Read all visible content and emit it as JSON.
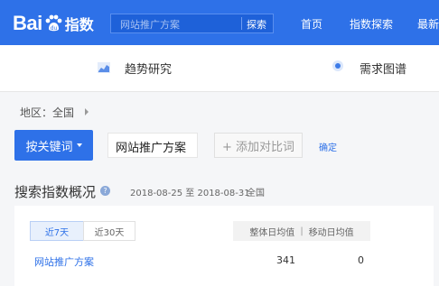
{
  "header": {
    "logo_text": "Bai",
    "logo_suffix": "指数",
    "search_placeholder": "网站推广方案",
    "search_button": "探索",
    "nav": [
      "首页",
      "指数探索",
      "最新"
    ]
  },
  "subnav": {
    "trend_label": "趋势研究",
    "map_label": "需求图谱"
  },
  "filters": {
    "region": "地区：全国",
    "keyword_button": "按关键词",
    "keyword_value": "网站推广方案",
    "add_compare": "+ 添加对比词",
    "confirm": "确定"
  },
  "overview": {
    "title": "搜索指数概况",
    "date_range": "2018-08-25 至 2018-08-31",
    "area": "全国",
    "tabs": [
      "近7天",
      "近30天"
    ],
    "columns": [
      "整体日均值",
      "移动日均值"
    ],
    "rows": [
      {
        "keyword": "网站推广方案",
        "overall": "341",
        "mobile": "0"
      }
    ]
  },
  "colors": {
    "brand": "#2e71e8"
  }
}
